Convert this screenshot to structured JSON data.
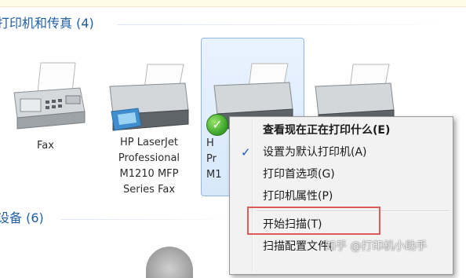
{
  "sections": {
    "printers_header": "打印机和传真 (4)",
    "devices_header": "设备 (6)"
  },
  "devices": [
    {
      "label": "Fax",
      "icon": "fax-icon"
    },
    {
      "label": "HP LaserJet\nProfessional\nM1210 MFP\nSeries Fax",
      "icon": "printer-icon"
    },
    {
      "label_visible": "H\nPr\nM1",
      "icon": "printer-icon",
      "selected": true,
      "default_badge": "check-icon"
    },
    {
      "label": "",
      "icon": "printer-icon"
    }
  ],
  "context_menu": {
    "items": [
      {
        "label": "查看现在正在打印什么(E)",
        "bold": true
      },
      {
        "label": "设置为默认打印机(A)",
        "checked": true,
        "check_mark": "✓"
      },
      {
        "label": "打印首选项(G)"
      },
      {
        "label": "打印机属性(P)"
      },
      {
        "label": "开始扫描(T)",
        "highlighted": true
      },
      {
        "label": "扫描配置文件("
      }
    ]
  },
  "watermark": "知乎 @打印机小助手",
  "colors": {
    "header_blue": "#1f5fa8",
    "selection_border": "#8fb8e6",
    "highlight_red": "#e05a5a",
    "menu_bg": "#f2f2f2"
  }
}
